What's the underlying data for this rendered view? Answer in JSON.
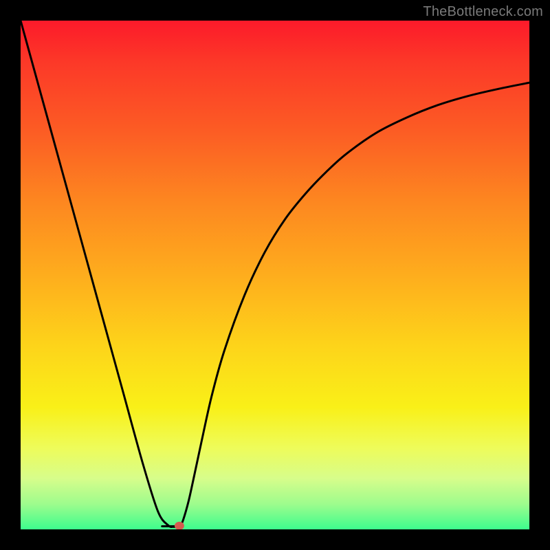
{
  "watermark": {
    "text": "TheBottleneck.com"
  },
  "chart_data": {
    "type": "line",
    "title": "",
    "xlabel": "",
    "ylabel": "",
    "xlim": [
      0,
      1
    ],
    "ylim": [
      0,
      1
    ],
    "series": [
      {
        "name": "curve",
        "x": [
          0.0,
          0.04,
          0.08,
          0.12,
          0.16,
          0.2,
          0.24,
          0.27,
          0.29,
          0.3,
          0.308,
          0.315,
          0.32,
          0.33,
          0.34,
          0.355,
          0.375,
          0.4,
          0.44,
          0.48,
          0.52,
          0.56,
          0.6,
          0.64,
          0.7,
          0.76,
          0.82,
          0.88,
          0.94,
          1.0
        ],
        "y": [
          1.0,
          0.855,
          0.71,
          0.565,
          0.42,
          0.275,
          0.13,
          0.035,
          0.008,
          0.005,
          0.006,
          0.01,
          0.02,
          0.055,
          0.1,
          0.17,
          0.26,
          0.35,
          0.46,
          0.545,
          0.61,
          0.66,
          0.702,
          0.738,
          0.78,
          0.81,
          0.834,
          0.852,
          0.866,
          0.878
        ]
      }
    ],
    "marker": {
      "x": 0.312,
      "y": 0.007,
      "color": "#d45a4f",
      "rx": 7,
      "ry": 6
    },
    "flat_segment": {
      "x0": 0.278,
      "x1": 0.31,
      "y": 0.006
    },
    "colors": {
      "curve_stroke": "#000000",
      "background_gradient": [
        "#fc1a2a",
        "#fead1d",
        "#f9f018",
        "#3dfc8d"
      ],
      "frame": "#000000"
    }
  }
}
